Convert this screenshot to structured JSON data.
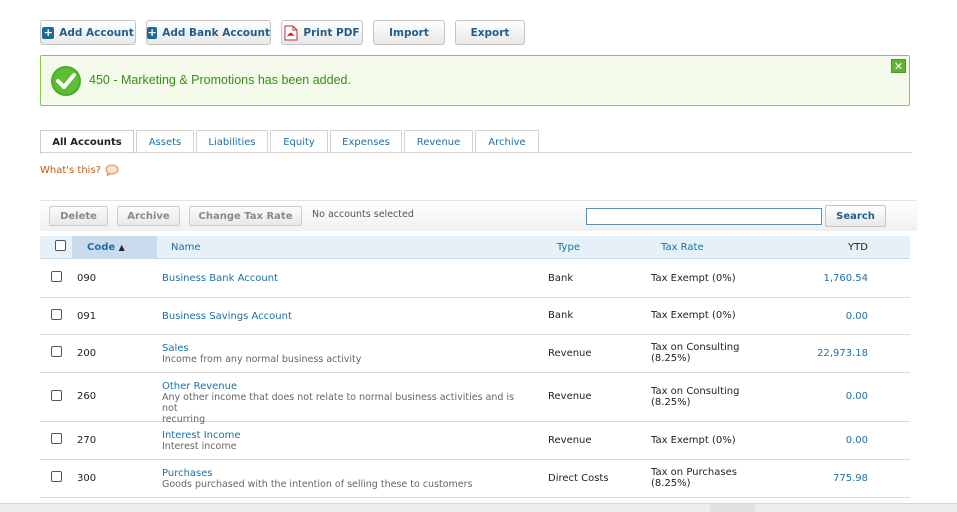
{
  "toolbar": {
    "add_account": "Add Account",
    "add_bank_account": "Add Bank Account",
    "print_pdf": "Print PDF",
    "import": "Import",
    "export": "Export"
  },
  "notice": {
    "message": "450 - Marketing & Promotions has been added.",
    "close_label": "x",
    "color": "#3c8d1a"
  },
  "tabs": [
    "All Accounts",
    "Assets",
    "Liabilities",
    "Equity",
    "Expenses",
    "Revenue",
    "Archive"
  ],
  "active_tab": "All Accounts",
  "whats_this": "What's this?",
  "actions": {
    "delete": "Delete",
    "archive": "Archive",
    "change_tax_rate": "Change Tax Rate",
    "selection_status": "No accounts selected",
    "search_placeholder": "",
    "search_button": "Search"
  },
  "table": {
    "headers": {
      "code": "Code",
      "sort_indicator": "▲",
      "name": "Name",
      "type": "Type",
      "tax_rate": "Tax Rate",
      "ytd": "YTD"
    },
    "rows": [
      {
        "code": "090",
        "name": "Business Bank Account",
        "description": "",
        "type": "Bank",
        "tax_rate_1": "Tax Exempt (0%)",
        "tax_rate_2": "",
        "ytd": "1,760.54"
      },
      {
        "code": "091",
        "name": "Business Savings Account",
        "description": "",
        "type": "Bank",
        "tax_rate_1": "Tax Exempt (0%)",
        "tax_rate_2": "",
        "ytd": "0.00"
      },
      {
        "code": "200",
        "name": "Sales",
        "description": "Income from any normal business activity",
        "type": "Revenue",
        "tax_rate_1": "Tax on Consulting",
        "tax_rate_2": "(8.25%)",
        "ytd": "22,973.18"
      },
      {
        "code": "260",
        "name": "Other Revenue",
        "description": "Any other income that does not relate to normal business activities and is not",
        "description_2": "recurring",
        "type": "Revenue",
        "tax_rate_1": "Tax on Consulting",
        "tax_rate_2": "(8.25%)",
        "ytd": "0.00"
      },
      {
        "code": "270",
        "name": "Interest Income",
        "description": "Interest income",
        "type": "Revenue",
        "tax_rate_1": "Tax Exempt (0%)",
        "tax_rate_2": "",
        "ytd": "0.00"
      },
      {
        "code": "300",
        "name": "Purchases",
        "description": "Goods purchased with the intention of selling these to customers",
        "type": "Direct Costs",
        "tax_rate_1": "Tax on Purchases",
        "tax_rate_2": "(8.25%)",
        "ytd": "775.98"
      }
    ]
  },
  "colors": {
    "link": "#1d6fa5",
    "success": "#5fb336",
    "header_bg": "#e6f0f8"
  }
}
